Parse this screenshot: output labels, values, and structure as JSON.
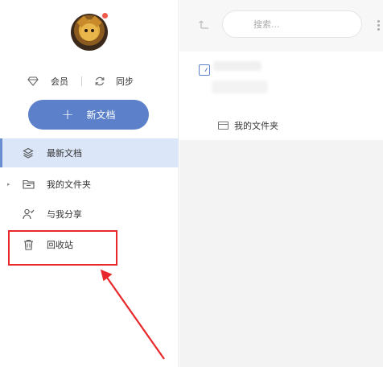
{
  "sidebar": {
    "membership_label": "会员",
    "sync_label": "同步",
    "new_doc_label": "新文档",
    "new_doc_plus": "+",
    "nav": [
      {
        "label": "最新文档"
      },
      {
        "label": "我的文件夹"
      },
      {
        "label": "与我分享"
      },
      {
        "label": "回收站"
      }
    ]
  },
  "main": {
    "search_placeholder": "搜索...",
    "folder_path": "我的文件夹"
  },
  "colors": {
    "accent": "#5c80c9",
    "active_bg": "#dbe6f8",
    "annotation": "#e8282a",
    "notification": "#f05a4a"
  }
}
